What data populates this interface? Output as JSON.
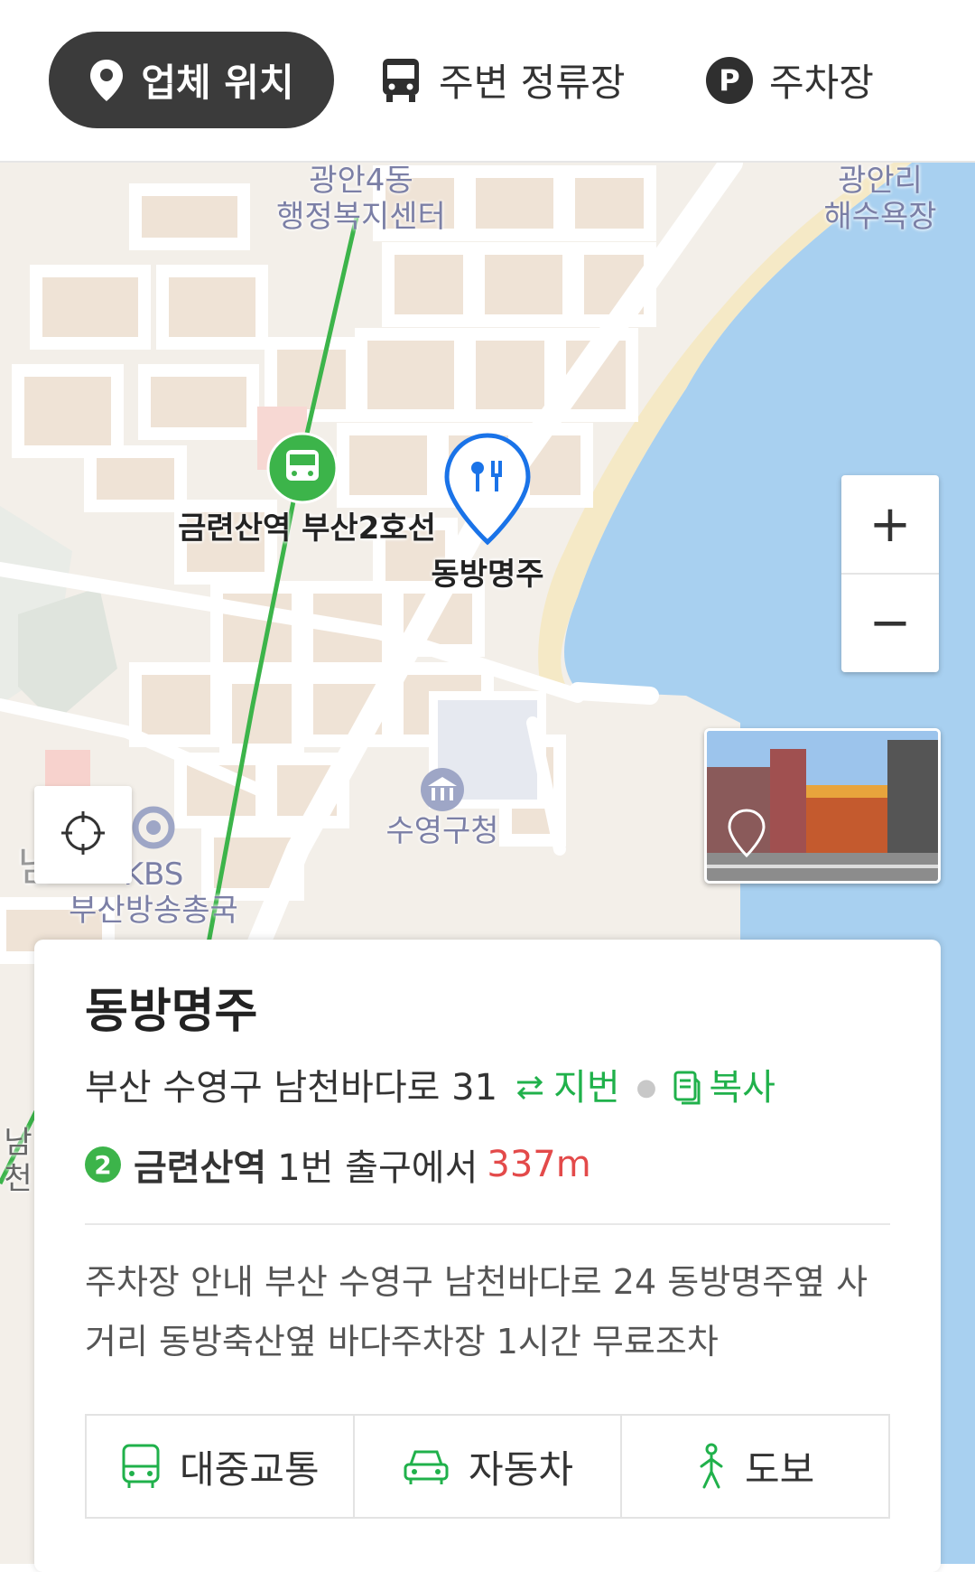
{
  "tabs": {
    "location": "업체 위치",
    "bus_stops": "주변 정류장",
    "parking": "주차장",
    "parking_icon_letter": "P"
  },
  "map": {
    "labels": {
      "gwangan4": "광안4동\n행정복지센터",
      "beach": "광안리\n해수욕장",
      "station": "금련산역 부산2호선",
      "place": "동방명주",
      "district_office": "수영구청",
      "kbs": "KBS\n부산방송총국",
      "area_left": "남",
      "area_left2": "남천"
    },
    "zoom_in": "+",
    "zoom_out": "−",
    "colors": {
      "water": "#a8d0f0",
      "subway_line": "#3cb44a",
      "pin": "#1a73e8"
    }
  },
  "place": {
    "name": "동방명주",
    "address": "부산 수영구 남천바다로 31",
    "jibun_label": "지번",
    "copy_label": "복사",
    "line_number": "2",
    "station": "금련산역",
    "exit_text": "1번 출구에서",
    "distance": "337m",
    "description": "주차장 안내 부산 수영구 남천바다로 24 동방명주옆 사거리 동방축산옆 바다주차장 1시간 무료조차"
  },
  "routes": {
    "transit": "대중교통",
    "car": "자동차",
    "walk": "도보"
  }
}
